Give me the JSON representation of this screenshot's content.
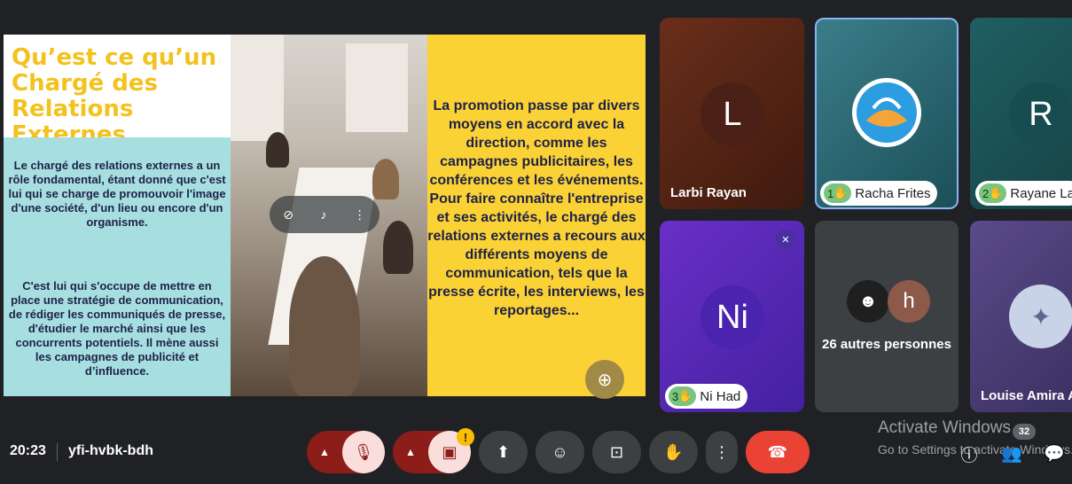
{
  "slide": {
    "title": "Qu’est ce qu’un Chargé des Relations Externes",
    "para1": "Le chargé des relations externes a un rôle fondamental, étant donné que c'est lui qui se charge de promouvoir l'image d'une société, d'un lieu ou encore d'un organisme.",
    "para2": "C'est lui qui s'occupe de mettre en place une stratégie de communication, de rédiger les communiqués de presse, d'étudier le marché ainsi que les concurrents potentiels. Il mène aussi les campagnes de publicité et d’influence.",
    "right_text": "La promotion passe par divers moyens en accord avec la direction, comme les campagnes publicitaires, les conférences et les événements. Pour faire connaître l'entreprise et ses activités, le chargé des relations externes a recours aux différents moyens de communication, tels que la presse écrite, les interviews, les reportages..."
  },
  "participants": [
    {
      "name": "Larbi Rayan",
      "initial": "L"
    },
    {
      "name": "Racha Frites",
      "hand": "1"
    },
    {
      "name": "Rayane La",
      "initial": "R",
      "hand": "2"
    },
    {
      "name": "Ni Had",
      "initial": "Ni",
      "hand": "3"
    },
    {
      "name": "26 autres personnes",
      "initial": "h"
    },
    {
      "name": "Louise Amira A"
    }
  ],
  "meeting": {
    "time": "20:23",
    "code": "yfi-hvbk-bdh"
  },
  "watermark": {
    "line1": "Activate Windows",
    "line2": "Go to Settings to activate Windows."
  },
  "people_count": "32",
  "warning_mark": "!",
  "colors": {
    "accent_blue": "#8ab4f8",
    "end_call": "#ea4335",
    "muted_bg": "#f9dedc",
    "slide_yellow": "#fbd235",
    "slide_teal": "#a7dfe0"
  }
}
